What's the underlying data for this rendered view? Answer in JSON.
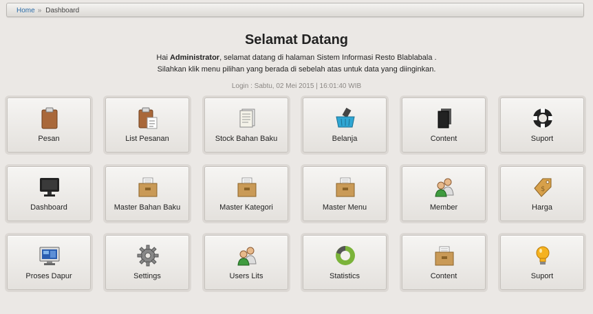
{
  "breadcrumb": {
    "home": "Home",
    "separator": "»",
    "current": "Dashboard"
  },
  "welcome": {
    "title": "Selamat Datang",
    "greeting_pre": "Hai ",
    "user": "Administrator",
    "greeting_post": ", selamat datang di halaman Sistem Informasi Resto Blablabala .",
    "instruction": "Silahkan klik menu pilihan yang berada di sebelah atas untuk data yang diinginkan.",
    "login": "Login : Sabtu, 02 Mei 2015 | 16:01:40 WIB"
  },
  "tiles": [
    {
      "label": "Pesan",
      "icon": "clipboard-icon"
    },
    {
      "label": "List Pesanan",
      "icon": "clipboard-list-icon"
    },
    {
      "label": "Stock Bahan Baku",
      "icon": "documents-icon"
    },
    {
      "label": "Belanja",
      "icon": "shopping-basket-icon"
    },
    {
      "label": "Content",
      "icon": "pages-icon"
    },
    {
      "label": "Suport",
      "icon": "lifebuoy-icon"
    },
    {
      "label": "Dashboard",
      "icon": "monitor-icon"
    },
    {
      "label": "Master Bahan Baku",
      "icon": "drawer-icon"
    },
    {
      "label": "Master Kategori",
      "icon": "drawer-icon"
    },
    {
      "label": "Master Menu",
      "icon": "drawer-icon"
    },
    {
      "label": "Member",
      "icon": "users-icon"
    },
    {
      "label": "Harga",
      "icon": "price-tag-icon"
    },
    {
      "label": "Proses Dapur",
      "icon": "screen-icon"
    },
    {
      "label": "Settings",
      "icon": "gear-icon"
    },
    {
      "label": "Users Lits",
      "icon": "users-icon"
    },
    {
      "label": "Statistics",
      "icon": "pie-chart-icon"
    },
    {
      "label": "Content",
      "icon": "drawer-icon"
    },
    {
      "label": "Suport",
      "icon": "lightbulb-icon"
    }
  ]
}
